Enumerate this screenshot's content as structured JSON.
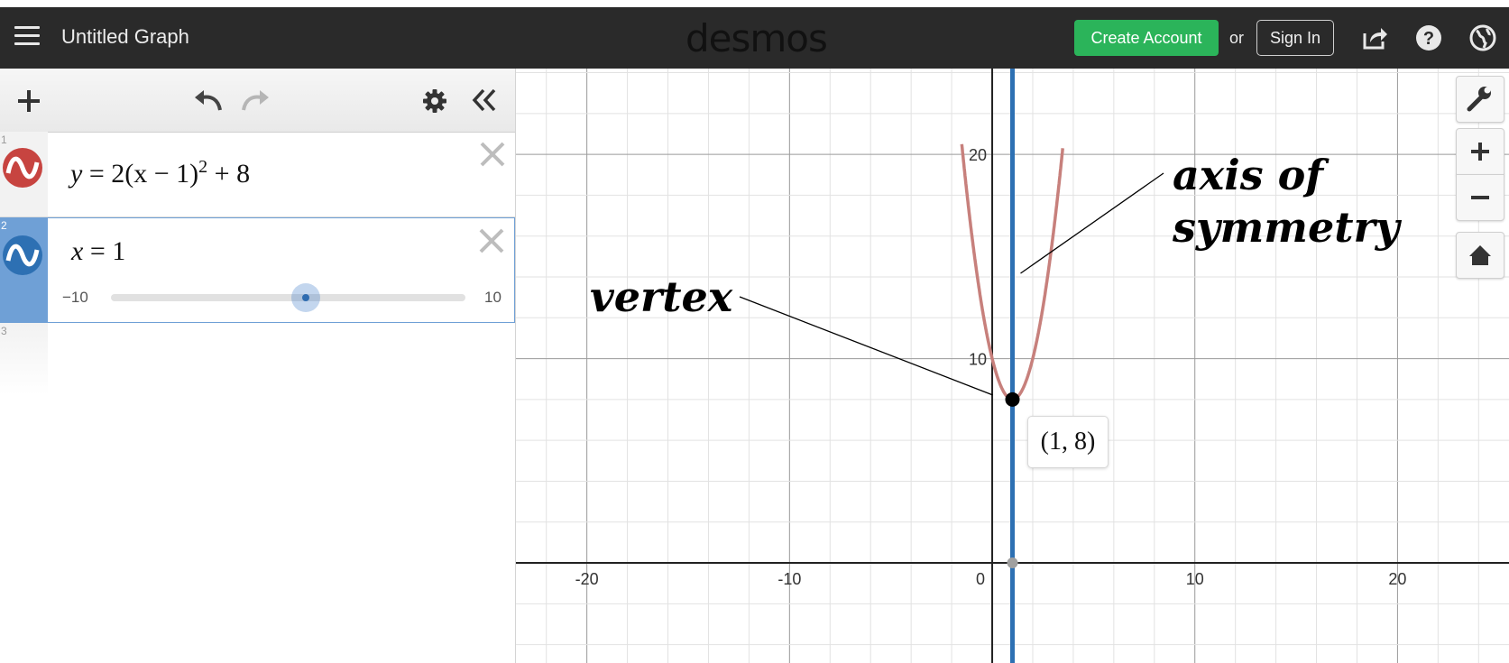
{
  "header": {
    "graph_title": "Untitled Graph",
    "brand": "desmos",
    "create_account_label": "Create Account",
    "or_label": "or",
    "sign_in_label": "Sign In",
    "icons": [
      "menu-icon",
      "share-icon",
      "help-icon",
      "globe-icon"
    ]
  },
  "colors": {
    "header_bg": "#2a2a2a",
    "create_account": "#2bb45a",
    "expr1": "#c74440",
    "expr2": "#2d70b3",
    "selected_row": "#6fa0d6"
  },
  "expressions": [
    {
      "index": "1",
      "lhs": "y",
      "rhs_pre": "2(x − 1)",
      "exponent": "2",
      "rhs_post": " + 8",
      "color": "#c74440"
    },
    {
      "index": "2",
      "lhs": "x",
      "rhs": "1",
      "color": "#2d70b3",
      "slider": {
        "min_label": "−10",
        "max_label": "10",
        "min": -10,
        "max": 10,
        "value": 1
      }
    },
    {
      "index": "3"
    }
  ],
  "graph": {
    "x_ticks": [
      "-20",
      "-10",
      "0",
      "10",
      "20"
    ],
    "y_ticks": [
      "10",
      "20"
    ],
    "x_range": [
      -23.5,
      25.5
    ],
    "y_range": [
      -4.9,
      24.2
    ],
    "point_label": "(1, 8)",
    "annotation_vertex": "vertex",
    "annotation_axis_line1": "axis of",
    "annotation_axis_line2": "symmetry"
  }
}
